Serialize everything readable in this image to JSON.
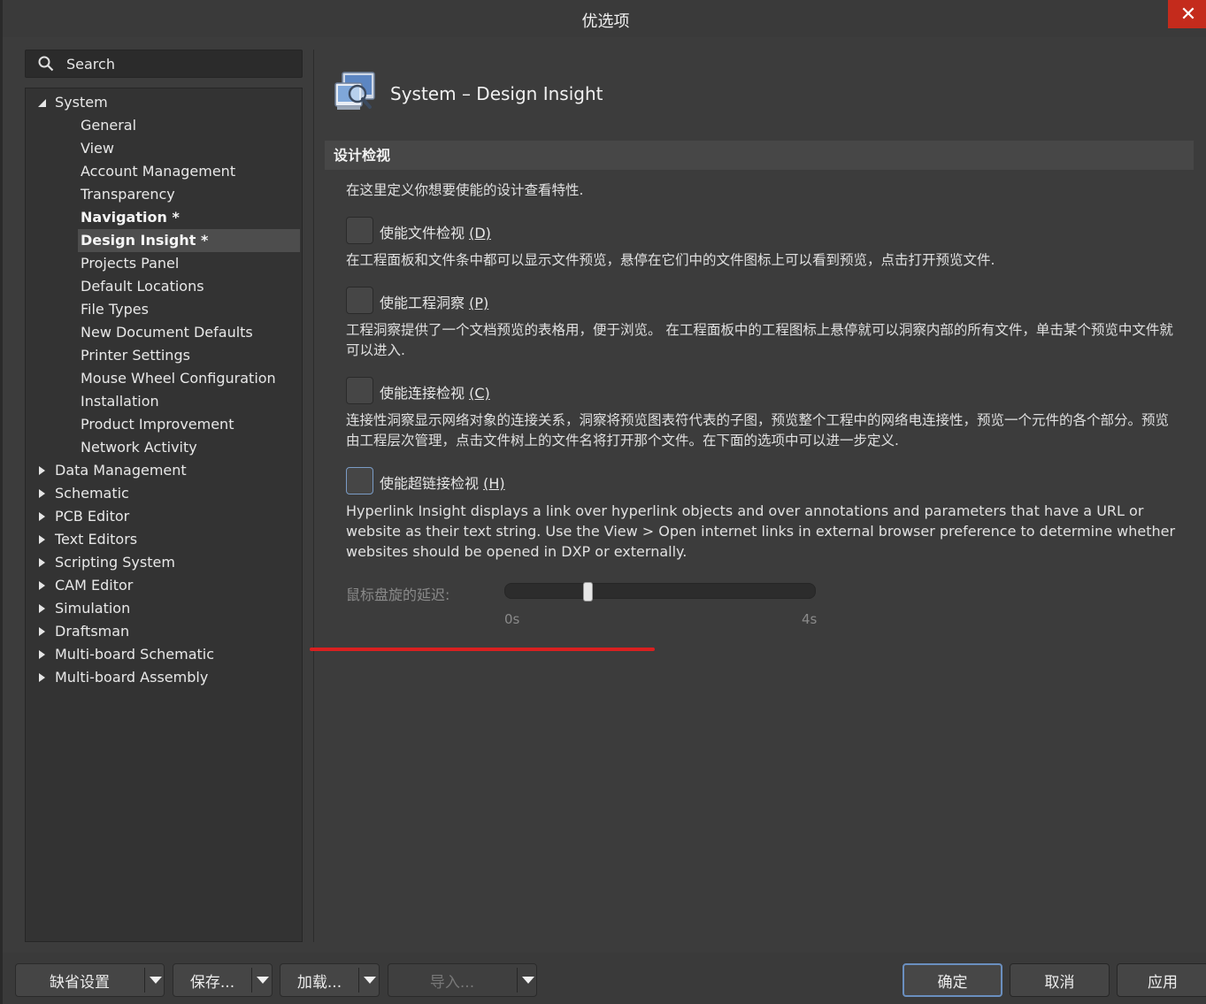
{
  "window": {
    "title": "优选项",
    "close_glyph": "✕"
  },
  "search": {
    "placeholder": "Search"
  },
  "tree": {
    "system": {
      "label": "System",
      "children": [
        {
          "label": "General"
        },
        {
          "label": "View"
        },
        {
          "label": "Account Management"
        },
        {
          "label": "Transparency"
        },
        {
          "label": "Navigation *"
        },
        {
          "label": "Design Insight *"
        },
        {
          "label": "Projects Panel"
        },
        {
          "label": "Default Locations"
        },
        {
          "label": "File Types"
        },
        {
          "label": "New Document Defaults"
        },
        {
          "label": "Printer Settings"
        },
        {
          "label": "Mouse Wheel Configuration"
        },
        {
          "label": "Installation"
        },
        {
          "label": "Product Improvement"
        },
        {
          "label": "Network Activity"
        }
      ]
    },
    "collapsed": [
      {
        "label": "Data Management"
      },
      {
        "label": "Schematic"
      },
      {
        "label": "PCB Editor"
      },
      {
        "label": "Text Editors"
      },
      {
        "label": "Scripting System"
      },
      {
        "label": "CAM Editor"
      },
      {
        "label": "Simulation"
      },
      {
        "label": "Draftsman"
      },
      {
        "label": "Multi-board Schematic"
      },
      {
        "label": "Multi-board Assembly"
      }
    ]
  },
  "page": {
    "title": "System – Design Insight",
    "section_title": "设计检视",
    "intro": "在这里定义你想要使能的设计查看特性.",
    "options": [
      {
        "label_text": "使能文件检视 ",
        "label_key": "(D)",
        "checked": false,
        "description": "在工程面板和文件条中都可以显示文件预览，悬停在它们中的文件图标上可以看到预览，点击打开预览文件."
      },
      {
        "label_text": "使能工程洞察 ",
        "label_key": "(P)",
        "checked": false,
        "description": "工程洞察提供了一个文档预览的表格用，便于浏览。 在工程面板中的工程图标上悬停就可以洞察内部的所有文件，单击某个预览中文件就可以进入."
      },
      {
        "label_text": "使能连接检视 ",
        "label_key": "(C)",
        "checked": false,
        "description": "连接性洞察显示网络对象的连接关系，洞察将预览图表符代表的子图，预览整个工程中的网络电连接性，预览一个元件的各个部分。预览由工程层次管理，点击文件树上的文件名将打开那个文件。在下面的选项中可以进一步定义."
      },
      {
        "label_text": "使能超链接检视 ",
        "label_key": "(H)",
        "checked": false,
        "description": "Hyperlink Insight displays a link over hyperlink objects and over annotations and parameters that have a URL or website as their text string. Use the View > Open internet links in external browser preference to determine whether websites should be opened in DXP or externally."
      }
    ],
    "slider": {
      "label": "鼠标盘旋的延迟:",
      "min_label": "0s",
      "max_label": "4s",
      "value_fraction": 0.26
    }
  },
  "footer": {
    "defaults_label": "缺省设置",
    "save_label": "保存...",
    "load_label": "加载...",
    "import_label": "导入...",
    "ok_label": "确定",
    "cancel_label": "取消",
    "apply_label": "应用"
  },
  "colors": {
    "background": "#3c3c3c",
    "panel": "#333333",
    "accent_focus": "#6a8fbf",
    "close_red": "#c42b1c",
    "annotation_red": "#d92020"
  }
}
